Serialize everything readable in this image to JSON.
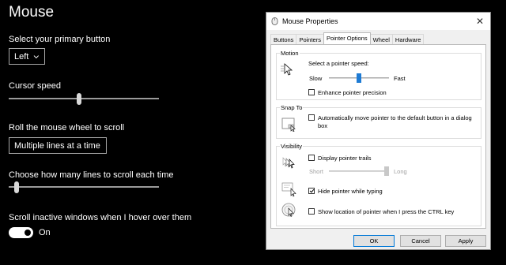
{
  "settings": {
    "title": "Mouse",
    "primary_button": {
      "label": "Select your primary button",
      "value": "Left"
    },
    "cursor_speed": {
      "label": "Cursor speed",
      "level": 0.47
    },
    "scroll_wheel": {
      "label": "Roll the mouse wheel to scroll",
      "value": "Multiple lines at a time"
    },
    "lines_to_scroll": {
      "label": "Choose how many lines to scroll each time",
      "level": 0.04
    },
    "scroll_inactive": {
      "label": "Scroll inactive windows when I hover over them",
      "state": "On"
    }
  },
  "dialog": {
    "title": "Mouse Properties",
    "tabs": [
      "Buttons",
      "Pointers",
      "Pointer Options",
      "Wheel",
      "Hardware"
    ],
    "active_tab": "Pointer Options",
    "motion": {
      "group_title": "Motion",
      "speed_label": "Select a pointer speed:",
      "slow": "Slow",
      "fast": "Fast",
      "speed_level": 0.5,
      "enhance_precision": {
        "label": "Enhance pointer precision",
        "checked": false
      }
    },
    "snap_to": {
      "group_title": "Snap To",
      "auto_move": {
        "label_line1": "Automatically move pointer to the default button in a dialog",
        "label_line2": "box",
        "checked": false
      }
    },
    "visibility": {
      "group_title": "Visibility",
      "trails": {
        "label": "Display pointer trails",
        "checked": false
      },
      "short": "Short",
      "long": "Long",
      "trail_level": 1.0,
      "hide_typing": {
        "label": "Hide pointer while typing",
        "checked": true
      },
      "show_location": {
        "label": "Show location of pointer when I press the CTRL key",
        "checked": false
      }
    },
    "buttons": {
      "ok": "OK",
      "cancel": "Cancel",
      "apply": "Apply"
    },
    "colors": {
      "accent": "#0078d7",
      "slider_thumb": "#1e7bd4"
    },
    "icons": [
      "mouse-icon",
      "close-icon",
      "pointer-speed-icon",
      "snap-to-icon",
      "pointer-trails-icon",
      "hide-pointer-icon",
      "pointer-location-icon"
    ]
  }
}
